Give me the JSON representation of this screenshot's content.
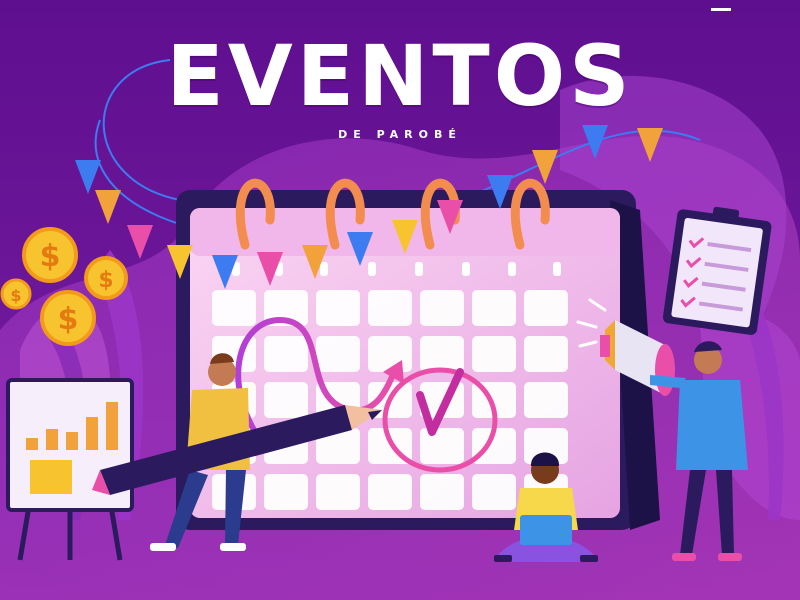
{
  "header": {
    "title": "EVENTOS",
    "subtitle": "DE PAROBÉ"
  },
  "icons": [
    "coin-icon",
    "megaphone-icon",
    "clipboard-icon",
    "pencil-icon",
    "checkmark-icon",
    "chart-icon"
  ],
  "colors": {
    "background": "#6a1596",
    "accent_pink": "#e94fa8",
    "calendar_face": "#f6c6ef",
    "calendar_frame": "#2b1b5e",
    "coin": "#f7c430"
  },
  "chart_board": {
    "bars": [
      0.2,
      0.35,
      0.3,
      0.55,
      0.8
    ]
  }
}
